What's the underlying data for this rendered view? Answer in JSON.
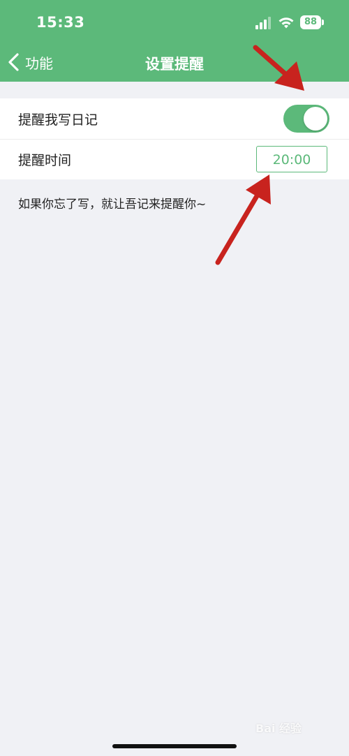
{
  "status_bar": {
    "time": "15:33",
    "battery": "88"
  },
  "nav": {
    "back_label": "功能",
    "title": "设置提醒"
  },
  "settings": {
    "reminder_toggle_label": "提醒我写日记",
    "reminder_toggle_on": true,
    "reminder_time_label": "提醒时间",
    "reminder_time_value": "20:00"
  },
  "hint": "如果你忘了写，就让吾记来提醒你~",
  "watermark": "Bai 经验",
  "colors": {
    "brand_green": "#5cb97a",
    "background": "#f0f1f5",
    "annotation_red": "#c8231e"
  },
  "icons": {
    "back": "chevron-left-icon",
    "signal": "cellular-signal-icon",
    "wifi": "wifi-icon",
    "battery": "battery-icon"
  }
}
